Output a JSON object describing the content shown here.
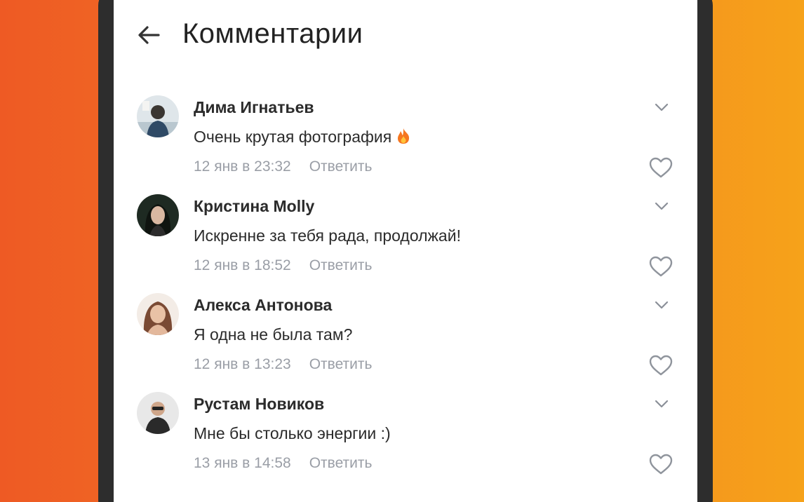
{
  "header": {
    "title": "Комментарии",
    "back_icon": "arrow-left-icon"
  },
  "comments": [
    {
      "author": "Дима Игнатьев",
      "text": "Очень крутая фотография",
      "emoji": "fire-icon",
      "date": "12 янв в 23:32",
      "reply_label": "Ответить"
    },
    {
      "author": "Кристина Molly",
      "text": "Искренне за тебя рада, продолжай!",
      "date": "12 янв в 18:52",
      "reply_label": "Ответить"
    },
    {
      "author": "Алекса Антонова",
      "text": "Я одна не была там?",
      "date": "12 янв в 13:23",
      "reply_label": "Ответить"
    },
    {
      "author": "Рустам Новиков",
      "text": "Мне бы столько энергии :)",
      "date": "13 янв в 14:58",
      "reply_label": "Ответить"
    }
  ],
  "colors": {
    "background_left": "#ee5a24",
    "background_right": "#f6a21a",
    "text_primary": "#2b2b2b",
    "text_secondary": "#9a9ea6"
  }
}
